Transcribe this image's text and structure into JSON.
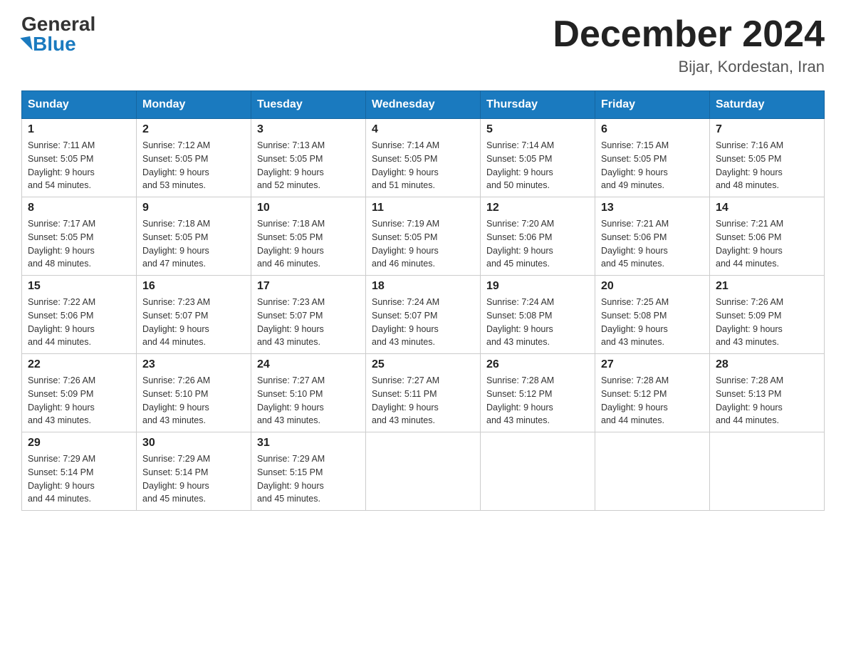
{
  "header": {
    "logo_general": "General",
    "logo_blue": "Blue",
    "month_title": "December 2024",
    "location": "Bijar, Kordestan, Iran"
  },
  "days_of_week": [
    "Sunday",
    "Monday",
    "Tuesday",
    "Wednesday",
    "Thursday",
    "Friday",
    "Saturday"
  ],
  "weeks": [
    [
      {
        "day": "1",
        "sunrise": "7:11 AM",
        "sunset": "5:05 PM",
        "daylight": "9 hours and 54 minutes."
      },
      {
        "day": "2",
        "sunrise": "7:12 AM",
        "sunset": "5:05 PM",
        "daylight": "9 hours and 53 minutes."
      },
      {
        "day": "3",
        "sunrise": "7:13 AM",
        "sunset": "5:05 PM",
        "daylight": "9 hours and 52 minutes."
      },
      {
        "day": "4",
        "sunrise": "7:14 AM",
        "sunset": "5:05 PM",
        "daylight": "9 hours and 51 minutes."
      },
      {
        "day": "5",
        "sunrise": "7:14 AM",
        "sunset": "5:05 PM",
        "daylight": "9 hours and 50 minutes."
      },
      {
        "day": "6",
        "sunrise": "7:15 AM",
        "sunset": "5:05 PM",
        "daylight": "9 hours and 49 minutes."
      },
      {
        "day": "7",
        "sunrise": "7:16 AM",
        "sunset": "5:05 PM",
        "daylight": "9 hours and 48 minutes."
      }
    ],
    [
      {
        "day": "8",
        "sunrise": "7:17 AM",
        "sunset": "5:05 PM",
        "daylight": "9 hours and 48 minutes."
      },
      {
        "day": "9",
        "sunrise": "7:18 AM",
        "sunset": "5:05 PM",
        "daylight": "9 hours and 47 minutes."
      },
      {
        "day": "10",
        "sunrise": "7:18 AM",
        "sunset": "5:05 PM",
        "daylight": "9 hours and 46 minutes."
      },
      {
        "day": "11",
        "sunrise": "7:19 AM",
        "sunset": "5:05 PM",
        "daylight": "9 hours and 46 minutes."
      },
      {
        "day": "12",
        "sunrise": "7:20 AM",
        "sunset": "5:06 PM",
        "daylight": "9 hours and 45 minutes."
      },
      {
        "day": "13",
        "sunrise": "7:21 AM",
        "sunset": "5:06 PM",
        "daylight": "9 hours and 45 minutes."
      },
      {
        "day": "14",
        "sunrise": "7:21 AM",
        "sunset": "5:06 PM",
        "daylight": "9 hours and 44 minutes."
      }
    ],
    [
      {
        "day": "15",
        "sunrise": "7:22 AM",
        "sunset": "5:06 PM",
        "daylight": "9 hours and 44 minutes."
      },
      {
        "day": "16",
        "sunrise": "7:23 AM",
        "sunset": "5:07 PM",
        "daylight": "9 hours and 44 minutes."
      },
      {
        "day": "17",
        "sunrise": "7:23 AM",
        "sunset": "5:07 PM",
        "daylight": "9 hours and 43 minutes."
      },
      {
        "day": "18",
        "sunrise": "7:24 AM",
        "sunset": "5:07 PM",
        "daylight": "9 hours and 43 minutes."
      },
      {
        "day": "19",
        "sunrise": "7:24 AM",
        "sunset": "5:08 PM",
        "daylight": "9 hours and 43 minutes."
      },
      {
        "day": "20",
        "sunrise": "7:25 AM",
        "sunset": "5:08 PM",
        "daylight": "9 hours and 43 minutes."
      },
      {
        "day": "21",
        "sunrise": "7:26 AM",
        "sunset": "5:09 PM",
        "daylight": "9 hours and 43 minutes."
      }
    ],
    [
      {
        "day": "22",
        "sunrise": "7:26 AM",
        "sunset": "5:09 PM",
        "daylight": "9 hours and 43 minutes."
      },
      {
        "day": "23",
        "sunrise": "7:26 AM",
        "sunset": "5:10 PM",
        "daylight": "9 hours and 43 minutes."
      },
      {
        "day": "24",
        "sunrise": "7:27 AM",
        "sunset": "5:10 PM",
        "daylight": "9 hours and 43 minutes."
      },
      {
        "day": "25",
        "sunrise": "7:27 AM",
        "sunset": "5:11 PM",
        "daylight": "9 hours and 43 minutes."
      },
      {
        "day": "26",
        "sunrise": "7:28 AM",
        "sunset": "5:12 PM",
        "daylight": "9 hours and 43 minutes."
      },
      {
        "day": "27",
        "sunrise": "7:28 AM",
        "sunset": "5:12 PM",
        "daylight": "9 hours and 44 minutes."
      },
      {
        "day": "28",
        "sunrise": "7:28 AM",
        "sunset": "5:13 PM",
        "daylight": "9 hours and 44 minutes."
      }
    ],
    [
      {
        "day": "29",
        "sunrise": "7:29 AM",
        "sunset": "5:14 PM",
        "daylight": "9 hours and 44 minutes."
      },
      {
        "day": "30",
        "sunrise": "7:29 AM",
        "sunset": "5:14 PM",
        "daylight": "9 hours and 45 minutes."
      },
      {
        "day": "31",
        "sunrise": "7:29 AM",
        "sunset": "5:15 PM",
        "daylight": "9 hours and 45 minutes."
      },
      null,
      null,
      null,
      null
    ]
  ],
  "labels": {
    "sunrise_prefix": "Sunrise: ",
    "sunset_prefix": "Sunset: ",
    "daylight_prefix": "Daylight: "
  }
}
